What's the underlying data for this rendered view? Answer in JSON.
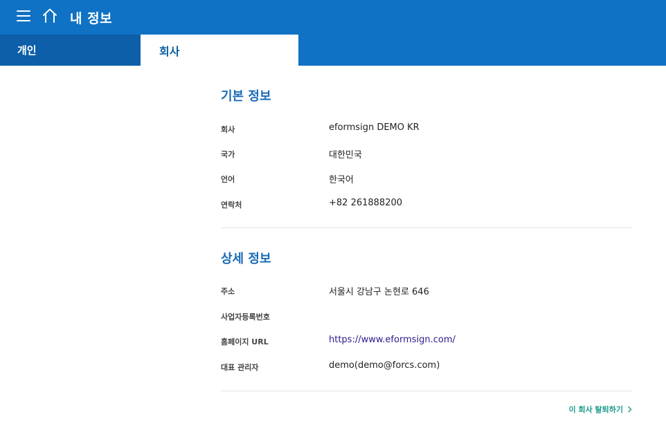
{
  "header": {
    "title": "내 정보"
  },
  "tabs": [
    {
      "label": "개인"
    },
    {
      "label": "회사"
    }
  ],
  "basic_info": {
    "title": "기본 정보",
    "rows": [
      {
        "label": "회사",
        "value": "eformsign DEMO KR"
      },
      {
        "label": "국가",
        "value": "대한민국"
      },
      {
        "label": "언어",
        "value": "한국어"
      },
      {
        "label": "연락처",
        "value": "+82 261888200"
      }
    ]
  },
  "detail_info": {
    "title": "상세 정보",
    "rows": [
      {
        "label": "주소",
        "value": "서울시 강남구 논현로 646"
      },
      {
        "label": "사업자등록번호",
        "value": ""
      },
      {
        "label": "홈페이지 URL",
        "value": "https://www.eformsign.com/"
      },
      {
        "label": "대표 관리자",
        "value": "demo(demo@forcs.com)"
      }
    ]
  },
  "footer": {
    "withdraw_label": "이 회사 탈퇴하기"
  },
  "colors": {
    "header_bg": "#0f72c4",
    "active_tab_dark": "#0c5fa8",
    "section_title": "#1a6bb8",
    "withdraw_link": "#1a9a8a"
  }
}
